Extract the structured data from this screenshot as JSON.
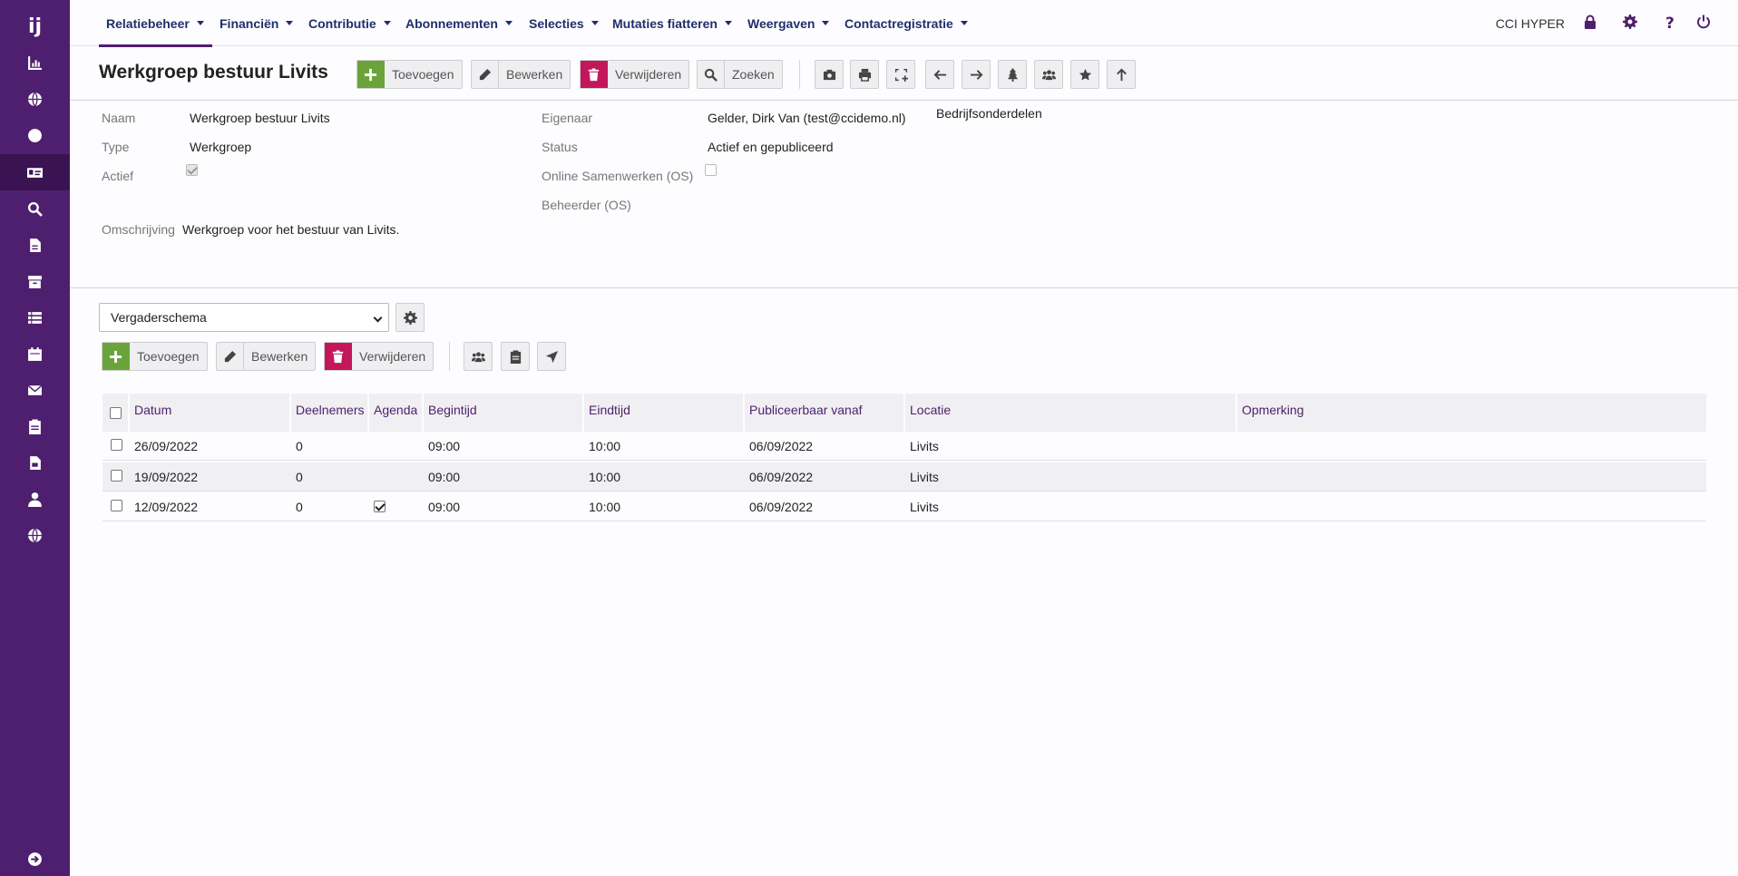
{
  "sidebar": {
    "logo": "ij",
    "items": [
      {
        "icon": "chart-icon"
      },
      {
        "icon": "globe-icon"
      },
      {
        "icon": "circle-icon"
      },
      {
        "icon": "id-card-icon"
      },
      {
        "icon": "search-icon"
      },
      {
        "icon": "document-icon"
      },
      {
        "icon": "archive-icon"
      },
      {
        "icon": "list-icon"
      },
      {
        "icon": "calendar-icon"
      },
      {
        "icon": "mail-icon"
      },
      {
        "icon": "clipboard-icon"
      },
      {
        "icon": "invoice-icon"
      },
      {
        "icon": "user-tie-icon"
      },
      {
        "icon": "globe-icon"
      }
    ],
    "bottom_icon": "sign-out-icon"
  },
  "nav": {
    "items": [
      "Relatiebeheer",
      "Financiën",
      "Contributie",
      "Abonnementen",
      "Selecties",
      "Mutaties fiatteren",
      "Weergaven",
      "Contactregistratie"
    ],
    "user_label": "CCI HYPER"
  },
  "header": {
    "title": "Werkgroep bestuur Livits",
    "add": "Toevoegen",
    "edit": "Bewerken",
    "delete": "Verwijderen",
    "search": "Zoeken"
  },
  "details": {
    "naam_label": "Naam",
    "naam": "Werkgroep bestuur Livits",
    "type_label": "Type",
    "type": "Werkgroep",
    "actief_label": "Actief",
    "actief": true,
    "omschrijving_label": "Omschrijving",
    "omschrijving": "Werkgroep voor het bestuur van Livits.",
    "eigenaar_label": "Eigenaar",
    "eigenaar": "Gelder, Dirk Van (test@ccidemo.nl)",
    "status_label": "Status",
    "status": "Actief en gepubliceerd",
    "os_label": "Online Samenwerken (OS)",
    "os": false,
    "beheerder_label": "Beheerder (OS)",
    "bedrijfsonderdelen": "Bedrijfsonderdelen"
  },
  "subsection": {
    "select_value": "Vergaderschema",
    "add": "Toevoegen",
    "edit": "Bewerken",
    "delete": "Verwijderen"
  },
  "table": {
    "columns": [
      "Datum",
      "Deelnemers",
      "Agenda",
      "Begintijd",
      "Eindtijd",
      "Publiceerbaar vanaf",
      "Locatie",
      "Opmerking"
    ],
    "rows": [
      {
        "datum": "26/09/2022",
        "deelnemers": "0",
        "agenda": false,
        "begintijd": "09:00",
        "eindtijd": "10:00",
        "publiceerbaar": "06/09/2022",
        "locatie": "Livits",
        "opmerking": ""
      },
      {
        "datum": "19/09/2022",
        "deelnemers": "0",
        "agenda": false,
        "begintijd": "09:00",
        "eindtijd": "10:00",
        "publiceerbaar": "06/09/2022",
        "locatie": "Livits",
        "opmerking": ""
      },
      {
        "datum": "12/09/2022",
        "deelnemers": "0",
        "agenda": true,
        "begintijd": "09:00",
        "eindtijd": "10:00",
        "publiceerbaar": "06/09/2022",
        "locatie": "Livits",
        "opmerking": ""
      }
    ]
  },
  "colors": {
    "sidebar": "#4e1f6e",
    "nav_text": "#1f2f6b",
    "add": "#6aa33a",
    "delete": "#c2185b"
  }
}
